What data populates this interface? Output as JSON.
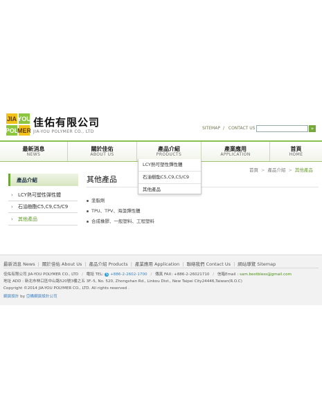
{
  "brand": {
    "logo_text": "JIA-YOU POLYMER",
    "name_cn": "佳佑有限公司",
    "name_en": "JIA-YOU POLYMER CO., LTD"
  },
  "toplinks": {
    "sitemap": "SITEMAP",
    "sep": "/",
    "contact": "CONTACT US",
    "search_placeholder": ""
  },
  "nav": [
    {
      "cn": "最新消息",
      "en": "NEWS"
    },
    {
      "cn": "關於佳佑",
      "en": "ABOUT US"
    },
    {
      "cn": "產品介紹",
      "en": "PRODUCTS"
    },
    {
      "cn": "產業應用",
      "en": "APPLICATION"
    },
    {
      "cn": "首頁",
      "en": "HOME"
    }
  ],
  "dropdown": [
    "LCY熱可塑性彈性體",
    "石油樹酯C5,C9,C5/C9",
    "其他產品"
  ],
  "breadcrumb": [
    "首頁",
    "產品介紹",
    "其他產品"
  ],
  "breadcrumb_sep": ">",
  "sidebar": {
    "title": "產品介紹",
    "items": [
      "LCY熱可塑性彈性體",
      "石油樹酯C5,C9,C5/C9",
      "其他產品"
    ]
  },
  "main": {
    "title": "其他產品",
    "items": [
      "塗脂劑",
      "TPU、TPV、海藻彈性體",
      "合成橡膠、一般塑料、工程塑料"
    ]
  },
  "footer": {
    "links": [
      "最新消息 News",
      "關於佳佑 About Us",
      "產品介紹 Products",
      "產業應用 Application",
      "聯絡我們 Contact Us",
      "網站導覽 Sitemap"
    ],
    "company": "佳佑有限公司 JIA-YOU POLYMER CO., LTD",
    "tel_label": "電話 TEL:",
    "tel": "+886-2-2602-1700",
    "fax": "傳真 FAX: +886-2-26021710",
    "email_label": "信箱Email :",
    "email": "sam.bestbless@gmail.com",
    "address": "地址 ADD : 新北市林口區中山路520號3樓之五 3F.-5, No. 520, Zhongshan Rd., Linkou Dist., New Taipei City24446,Taiwan(R.O.C)",
    "copyright": "Copyright ©2014 JIA-YOU POLYMER CO., LTD. All rights reserved .",
    "design_a": "網頁設計",
    "design_by": "by",
    "design_b": "亞橋網頁設計公司"
  },
  "colors": {
    "accent": "#6aa02e",
    "nav_border": "#8cbf52",
    "footer_bg": "#f2f2f2"
  }
}
